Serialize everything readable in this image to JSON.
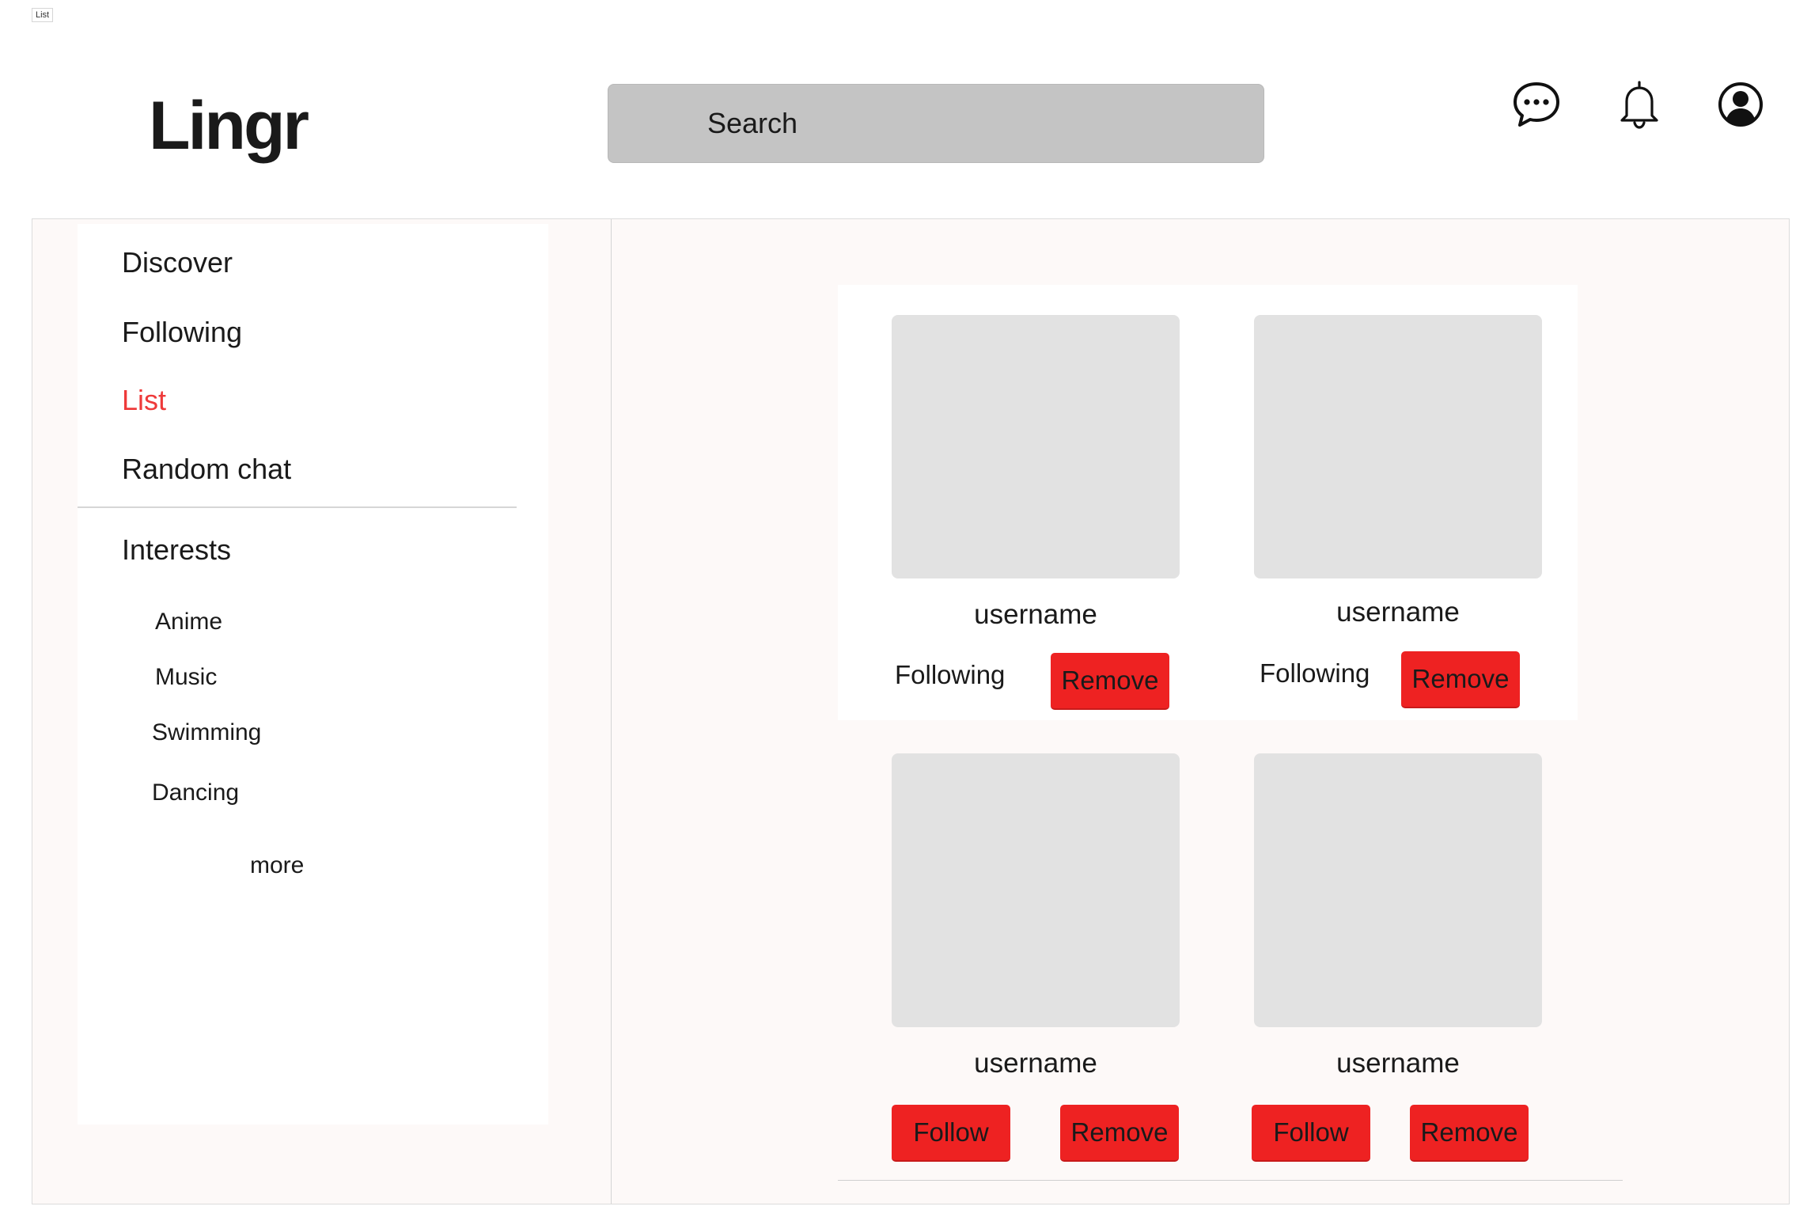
{
  "frame_label": "List",
  "header": {
    "logo": "Lingr",
    "search_placeholder": "Search",
    "icons": [
      "chat-bubble-icon",
      "bell-icon",
      "user-avatar-icon"
    ]
  },
  "sidebar": {
    "nav": [
      "Discover",
      "Following",
      "List",
      "Random chat"
    ],
    "active": "List",
    "interests_title": "Interests",
    "interests": [
      "Anime",
      "Music",
      "Swimming",
      "Dancing"
    ],
    "more_label": "more"
  },
  "cards": [
    {
      "username": "username",
      "status": "Following",
      "primary_action": "",
      "remove_label": "Remove"
    },
    {
      "username": "username",
      "status": "Following",
      "primary_action": "",
      "remove_label": "Remove"
    },
    {
      "username": "username",
      "status": "",
      "primary_action": "Follow",
      "remove_label": "Remove"
    },
    {
      "username": "username",
      "status": "",
      "primary_action": "Follow",
      "remove_label": "Remove"
    }
  ],
  "colors": {
    "accent": "#ee2222",
    "active_nav": "#ee3a3a",
    "search_bg": "#c4c4c4",
    "placeholder_img": "#e2e2e2"
  }
}
